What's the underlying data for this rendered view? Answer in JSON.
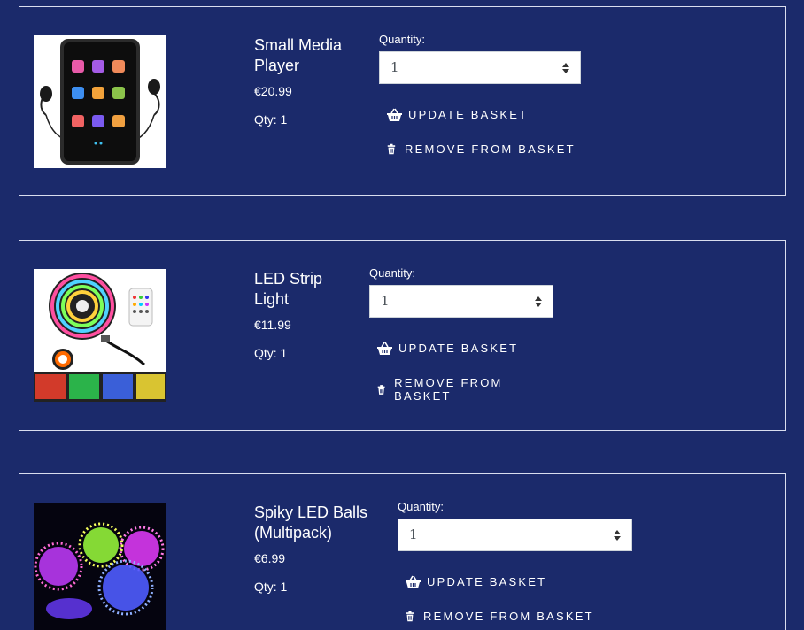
{
  "basket": {
    "quantity_label": "Quantity:",
    "update_label": "UPDATE BASKET",
    "remove_label": "REMOVE FROM BASKET",
    "items": [
      {
        "name": "Small Media Player",
        "price": "€20.99",
        "qty_text": "Qty: 1",
        "quantity_value": "1",
        "image_icon": "media-player-image"
      },
      {
        "name": "LED Strip Light",
        "price": "€11.99",
        "qty_text": "Qty: 1",
        "quantity_value": "1",
        "image_icon": "led-strip-image"
      },
      {
        "name": "Spiky LED Balls (Multipack)",
        "price": "€6.99",
        "qty_text": "Qty: 1",
        "quantity_value": "1",
        "image_icon": "led-balls-image"
      }
    ]
  },
  "colors": {
    "background": "#1b2a6b",
    "text": "#ffffff",
    "border": "#d9ddef"
  }
}
